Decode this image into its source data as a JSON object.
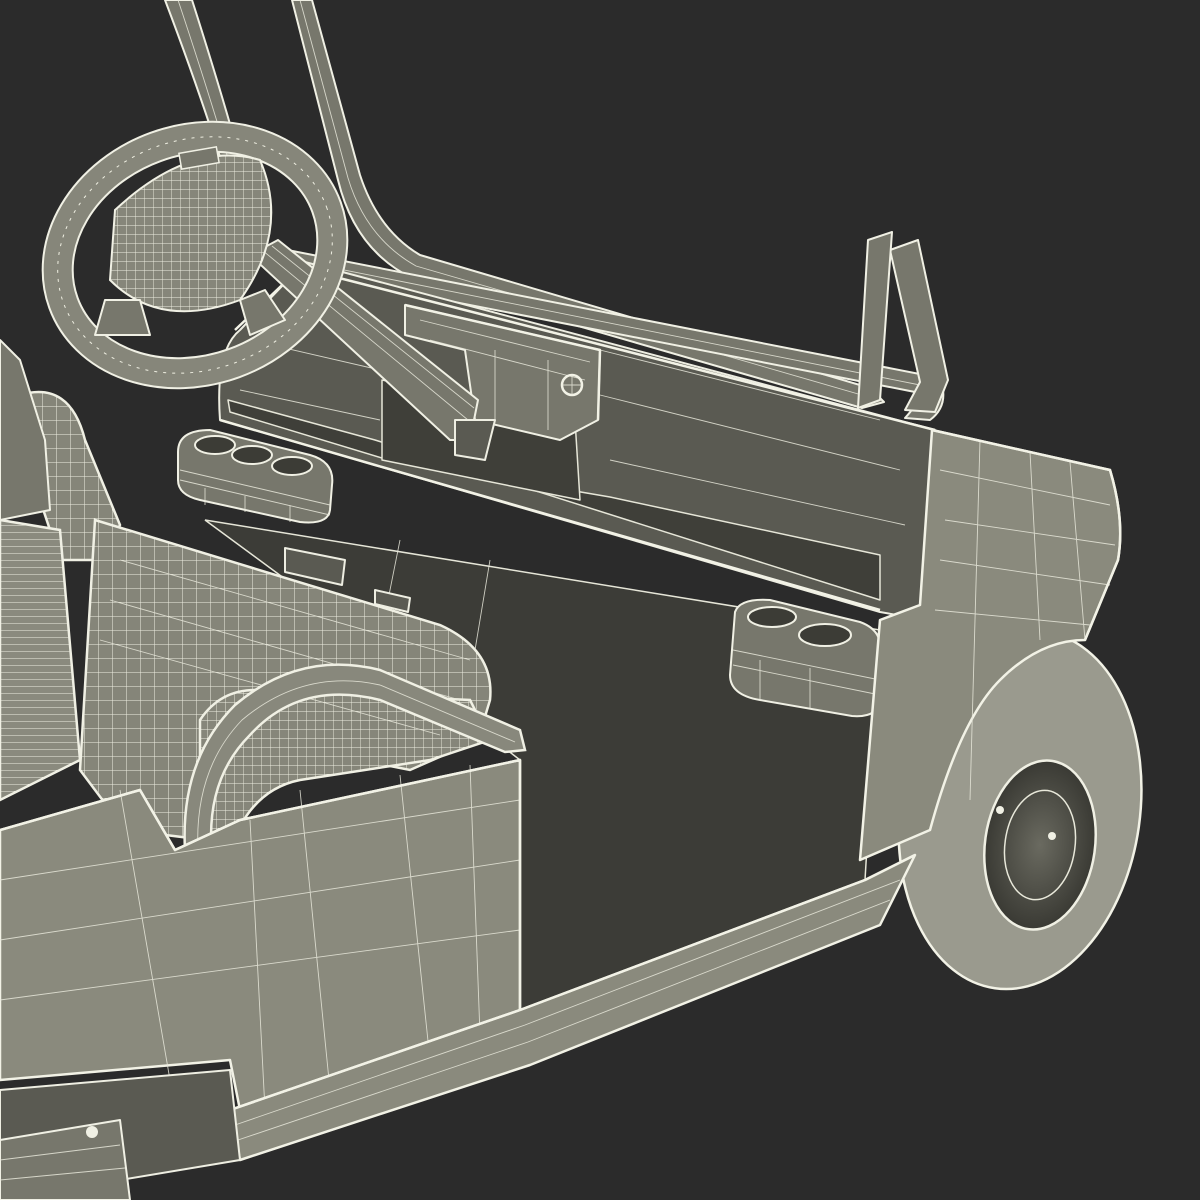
{
  "scene": {
    "background": "#2b2b2b",
    "model_color": "#8a8a7d",
    "wire_color": "#f2f2e6",
    "subject": "golf-cart-wireframe-render"
  }
}
